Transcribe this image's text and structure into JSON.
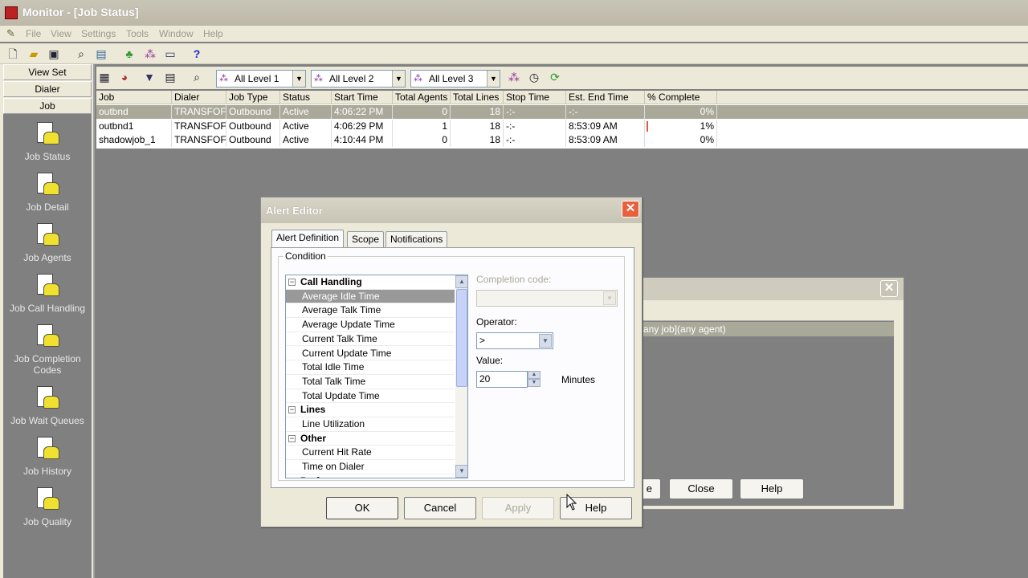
{
  "window": {
    "title": "Monitor - [Job Status]"
  },
  "menu": {
    "items": [
      "File",
      "View",
      "Settings",
      "Tools",
      "Window",
      "Help"
    ]
  },
  "nav": {
    "headers": [
      "View Set",
      "Dialer",
      "Job"
    ],
    "items": [
      "Job Status",
      "Job Detail",
      "Job Agents",
      "Job Call Handling",
      "Job Completion Codes",
      "Job Wait Queues",
      "Job History",
      "Job Quality"
    ]
  },
  "filters": {
    "level1": "All Level 1",
    "level2": "All Level 2",
    "level3": "All Level 3"
  },
  "grid": {
    "columns": [
      "Job",
      "Dialer",
      "Job Type",
      "Status",
      "Start Time",
      "Total Agents",
      "Total Lines",
      "Stop Time",
      "Est. End Time",
      "% Complete"
    ],
    "rows": [
      [
        "outbnd",
        "TRANSFOF",
        "Outbound",
        "Active",
        "4:06:22 PM",
        "0",
        "18",
        "-:-",
        "-:-",
        "0%"
      ],
      [
        "outbnd1",
        "TRANSFOF",
        "Outbound",
        "Active",
        "4:06:29 PM",
        "1",
        "18",
        "-:-",
        "8:53:09 AM",
        "1%"
      ],
      [
        "shadowjob_1",
        "TRANSFOF",
        "Outbound",
        "Active",
        "4:10:44 PM",
        "0",
        "18",
        "-:-",
        "8:53:09 AM",
        "0%"
      ]
    ],
    "selected_row": 0,
    "progress": [
      0,
      0.01,
      0
    ]
  },
  "bg_dialog": {
    "row_text": "any job](any agent)",
    "buttons": {
      "partial": "e",
      "close": "Close",
      "help": "Help"
    }
  },
  "dialog": {
    "title": "Alert Editor",
    "tabs": [
      "Alert Definition",
      "Scope",
      "Notifications"
    ],
    "active_tab": "Alert Definition",
    "condition_label": "Condition",
    "tree": [
      {
        "type": "group",
        "label": "Call Handling",
        "expander": "−"
      },
      {
        "type": "leaf",
        "label": "Average Idle Time",
        "selected": true
      },
      {
        "type": "leaf",
        "label": "Average Talk Time"
      },
      {
        "type": "leaf",
        "label": "Average Update Time"
      },
      {
        "type": "leaf",
        "label": "Current Talk Time"
      },
      {
        "type": "leaf",
        "label": "Current Update Time"
      },
      {
        "type": "leaf",
        "label": "Total Idle Time"
      },
      {
        "type": "leaf",
        "label": "Total Talk Time"
      },
      {
        "type": "leaf",
        "label": "Total Update Time"
      },
      {
        "type": "group",
        "label": "Lines",
        "expander": "−"
      },
      {
        "type": "leaf",
        "label": "Line Utilization"
      },
      {
        "type": "group",
        "label": "Other",
        "expander": "−"
      },
      {
        "type": "leaf",
        "label": "Current Hit Rate"
      },
      {
        "type": "leaf",
        "label": "Time on Dialer"
      },
      {
        "type": "group",
        "label": "Performance",
        "expander": "−"
      }
    ],
    "completion_code_label": "Completion code:",
    "completion_code_value": "",
    "operator_label": "Operator:",
    "operator_value": ">",
    "value_label": "Value:",
    "value": "20",
    "unit": "Minutes",
    "buttons": {
      "ok": "OK",
      "cancel": "Cancel",
      "apply": "Apply",
      "help": "Help"
    }
  }
}
